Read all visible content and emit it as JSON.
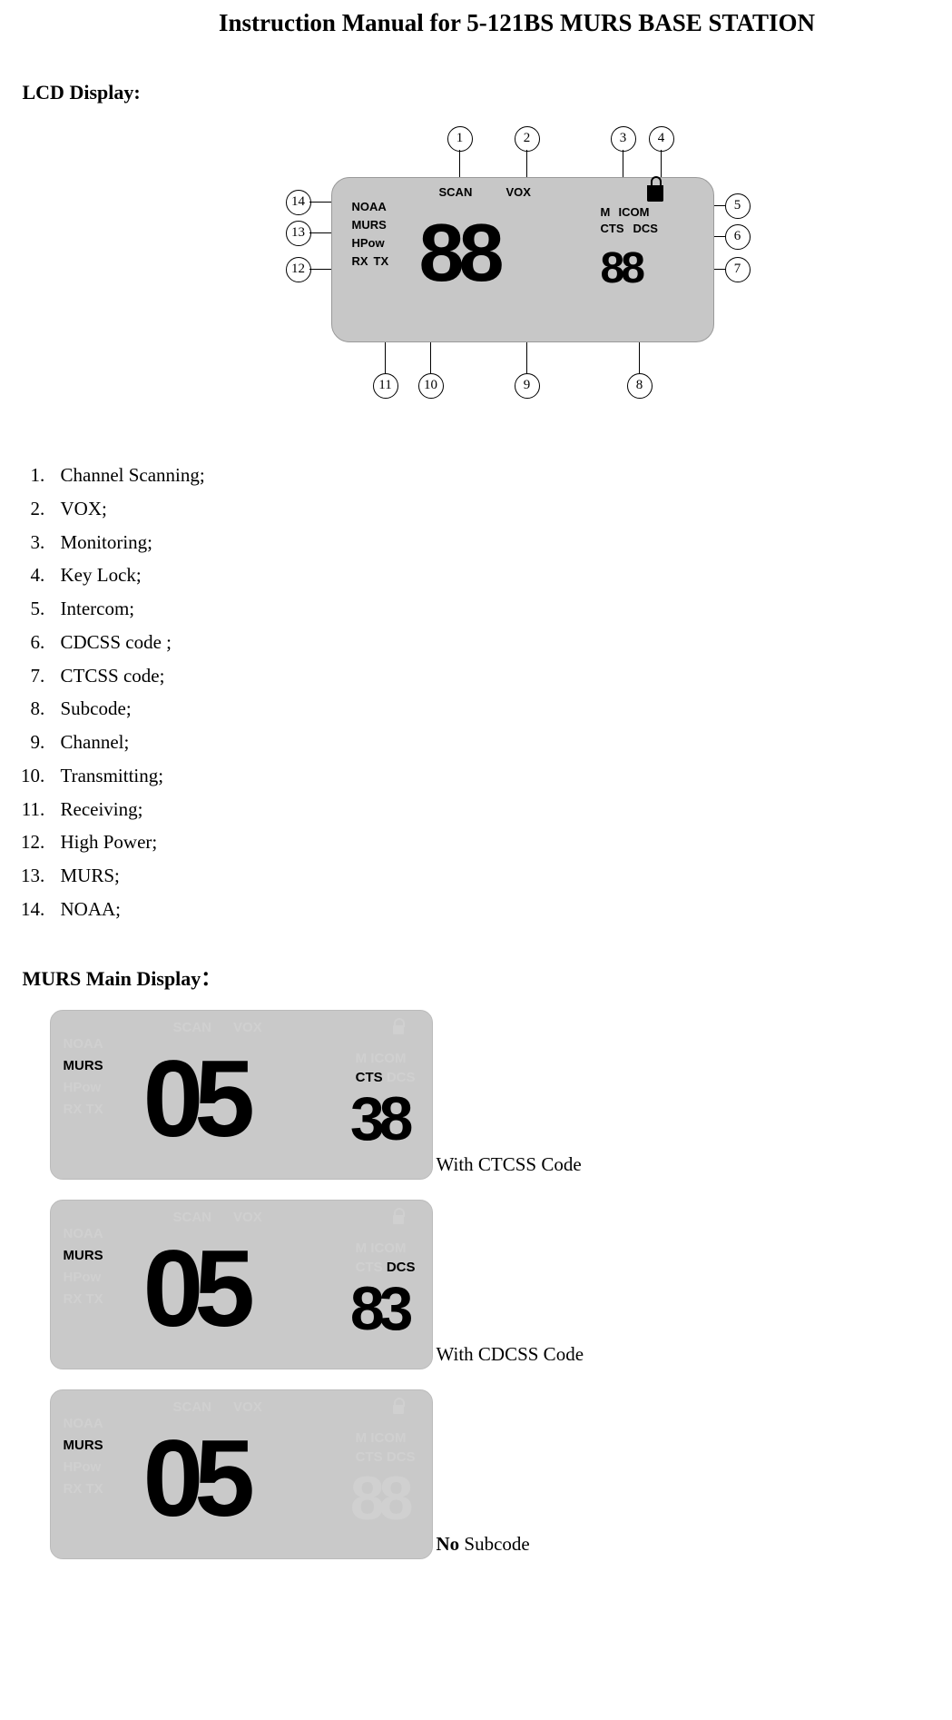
{
  "title": "Instruction Manual for 5-121BS MURS BASE STATION",
  "section1": "LCD Display:",
  "lcd": {
    "top": {
      "scan": "SCAN",
      "vox": "VOX"
    },
    "right": {
      "m": "M",
      "icom": "ICOM",
      "cts": "CTS",
      "dcs": "DCS"
    },
    "left": {
      "noaa": "NOAA",
      "murs": "MURS",
      "hpow": "HPow",
      "rx": "RX",
      "tx": "TX"
    },
    "big": "88",
    "small": "88"
  },
  "callouts": {
    "c1": "1",
    "c2": "2",
    "c3": "3",
    "c4": "4",
    "c5": "5",
    "c6": "6",
    "c7": "7",
    "c8": "8",
    "c9": "9",
    "c10": "10",
    "c11": "11",
    "c12": "12",
    "c13": "13",
    "c14": "14"
  },
  "items": [
    "Channel Scanning;",
    "VOX;",
    "Monitoring;",
    "Key Lock;",
    "Intercom;",
    "CDCSS code ;",
    "CTCSS code;",
    "Subcode;",
    "Channel;",
    "Transmitting;",
    "Receiving;",
    "High Power;",
    "MURS;",
    "NOAA;"
  ],
  "section2": "MURS Main Display：",
  "ex": {
    "faded": {
      "noaa": "NOAA",
      "hpow": "HPow",
      "rxtx": "RX TX",
      "scan": "SCAN",
      "vox": "VOX",
      "micom": "M ICOM",
      "ctsdcs": "CTS DCS",
      "cts": "CTS",
      "dcs": "DCS",
      "big88": "88"
    },
    "murs": "MURS",
    "a": {
      "ch": "05",
      "sub": "38",
      "code": "CTS",
      "caption": "With CTCSS Code"
    },
    "b": {
      "ch": "05",
      "sub": "83",
      "code": "DCS",
      "caption": "With CDCSS Code"
    },
    "c": {
      "ch": "05",
      "caption_bold": "No",
      "caption_rest": " Subcode"
    }
  }
}
